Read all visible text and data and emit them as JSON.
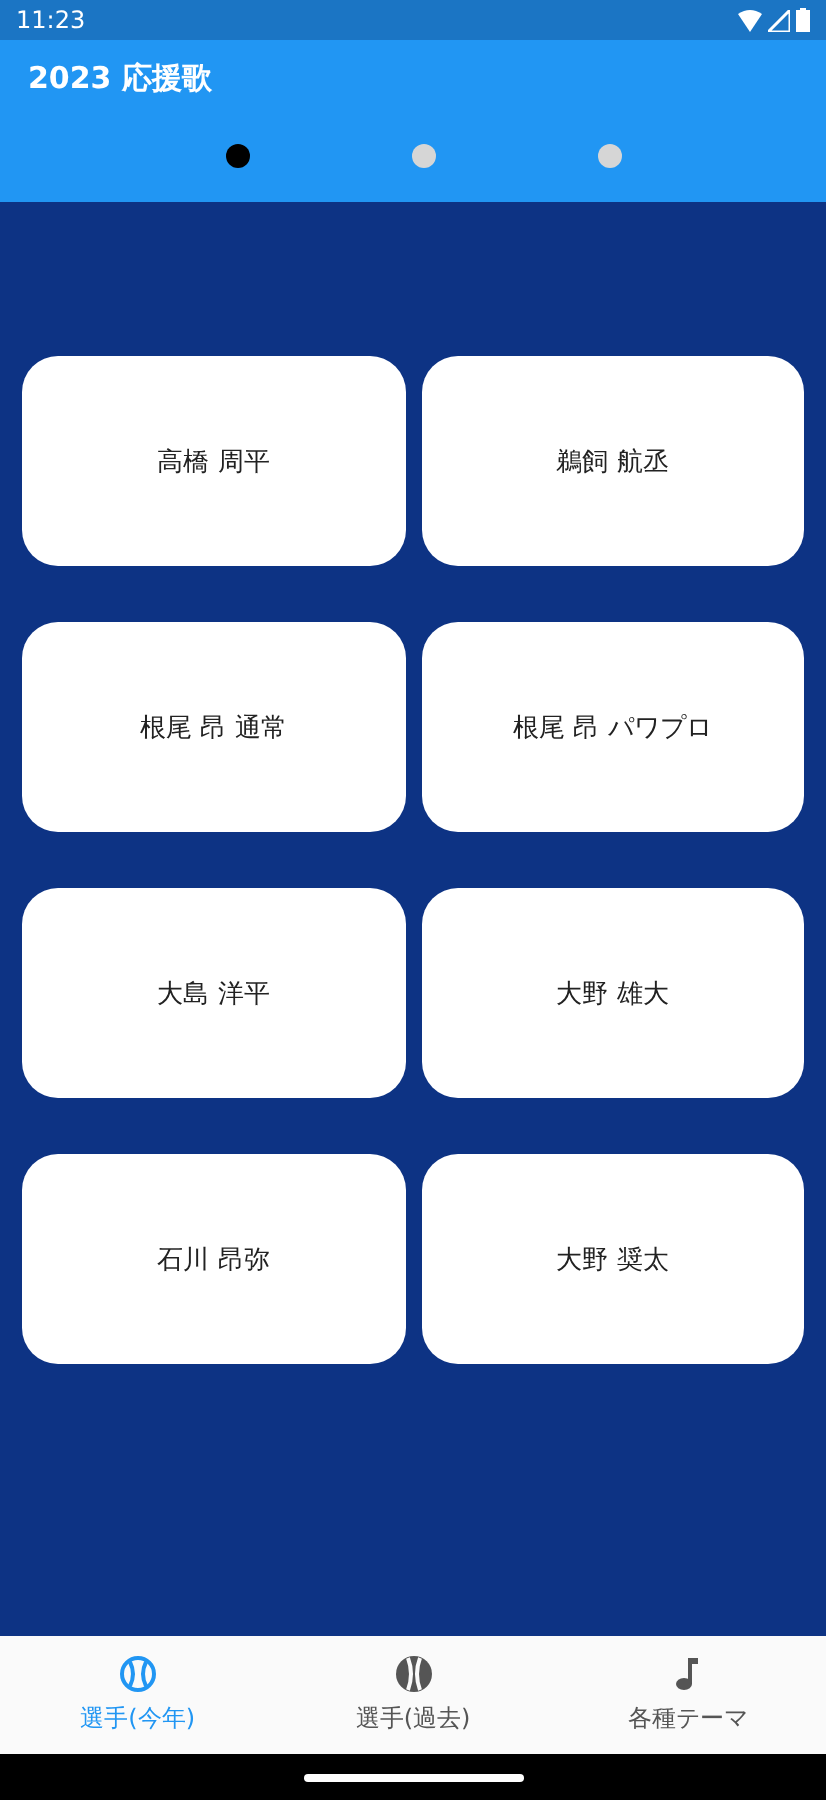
{
  "status_bar": {
    "time": "11:23"
  },
  "app_bar": {
    "title": "2023 応援歌"
  },
  "page_dots": [
    {
      "selected": true
    },
    {
      "selected": false
    },
    {
      "selected": false
    }
  ],
  "players": [
    {
      "name": "高橋 周平"
    },
    {
      "name": "鵜飼 航丞"
    },
    {
      "name": "根尾 昂 通常"
    },
    {
      "name": "根尾 昂 パワプロ"
    },
    {
      "name": "大島 洋平"
    },
    {
      "name": "大野 雄大"
    },
    {
      "name": "石川 昂弥"
    },
    {
      "name": "大野 奨太"
    }
  ],
  "bottom_nav": [
    {
      "label": "選手(今年)",
      "kind": "ball-outline",
      "selected": true
    },
    {
      "label": "選手(過去)",
      "kind": "ball-filled",
      "selected": false
    },
    {
      "label": "各種テーマ",
      "kind": "note",
      "selected": false
    }
  ]
}
